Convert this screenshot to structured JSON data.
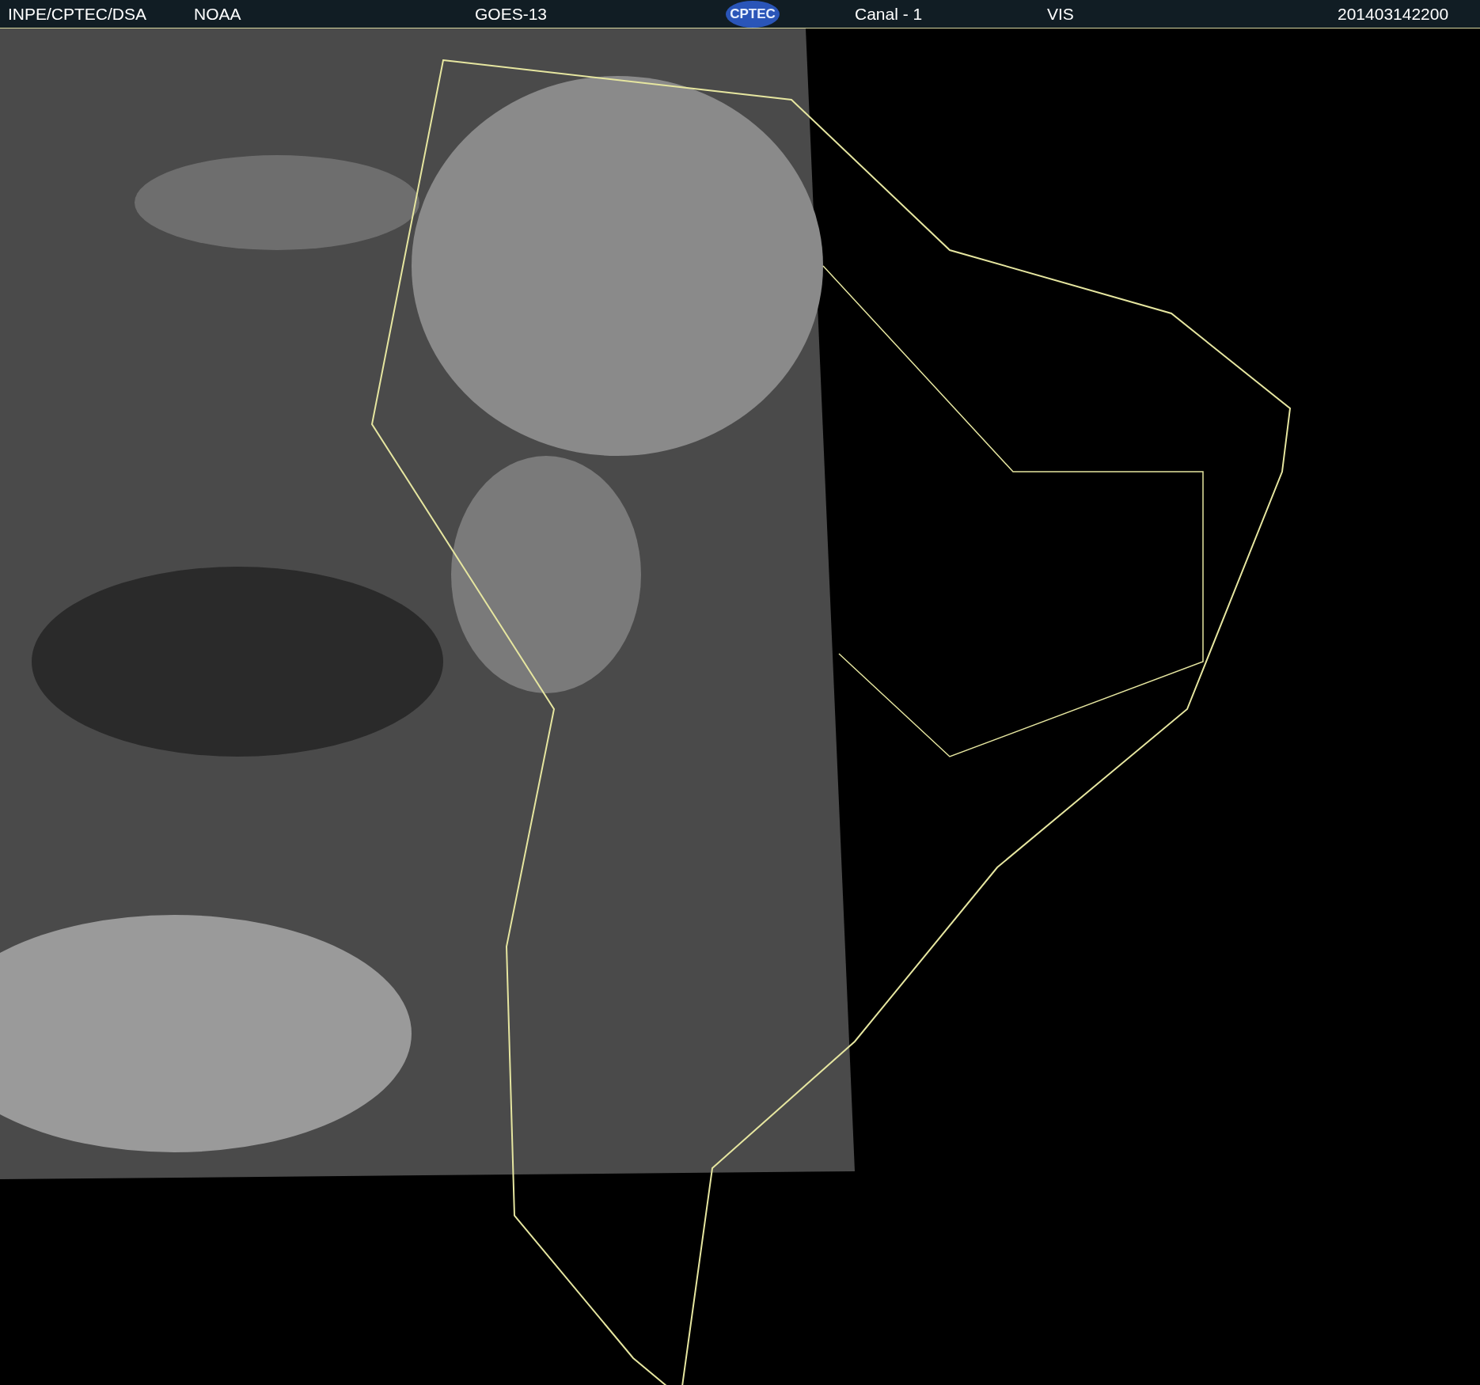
{
  "header": {
    "source": "INPE/CPTEC/DSA",
    "agency": "NOAA",
    "satellite": "GOES-13",
    "logo": "CPTEC",
    "channel": "Canal - 1",
    "band": "VIS",
    "timestamp": "201403142200"
  }
}
